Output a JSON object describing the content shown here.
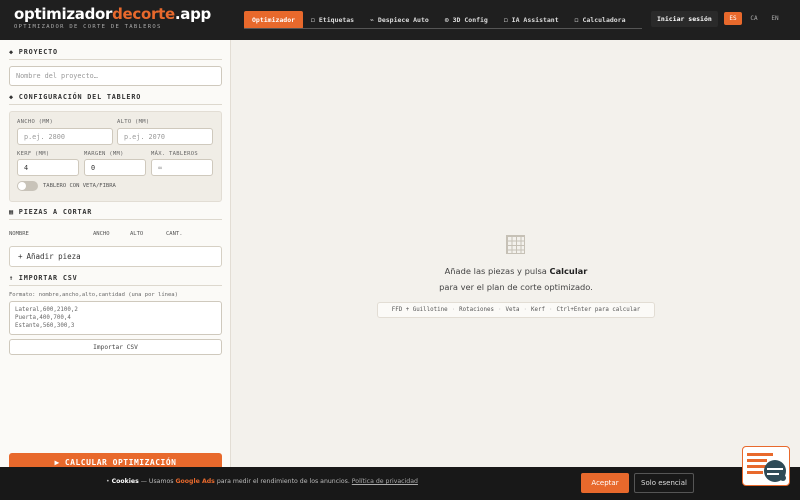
{
  "header": {
    "logo_main": "optimizador",
    "logo_accent": "decorte",
    "logo_tld": ".app",
    "logo_subtitle": "OPTIMIZADOR DE CORTE DE TABLEROS",
    "nav": [
      {
        "label": "Optimizador",
        "active": true
      },
      {
        "label": "◻ Etiquetas",
        "active": false
      },
      {
        "label": "⌁ Despiece Auto",
        "active": false
      },
      {
        "label": "⊙ 3D Config",
        "active": false
      },
      {
        "label": "◻ IA Assistant",
        "active": false
      },
      {
        "label": "◻ Calculadora",
        "active": false
      }
    ],
    "login_label": "Iniciar sesión",
    "languages": [
      {
        "code": "ES",
        "active": true
      },
      {
        "code": "CA",
        "active": false
      },
      {
        "code": "EN",
        "active": false
      }
    ]
  },
  "sidebar": {
    "project": {
      "title": "PROYECTO",
      "name_placeholder": "Nombre del proyecto…"
    },
    "board_config": {
      "title": "CONFIGURACIÓN DEL TABLERO",
      "width_label": "ANCHO (MM)",
      "width_placeholder": "p.ej. 2800",
      "height_label": "ALTO (MM)",
      "height_placeholder": "p.ej. 2070",
      "kerf_label": "KERF (MM)",
      "kerf_value": "4",
      "margin_label": "MARGEN (MM)",
      "margin_value": "0",
      "max_boards_label": "MÁX. TABLEROS",
      "max_boards_placeholder": "∞",
      "grain_toggle_label": "TABLERO CON VETA/FIBRA",
      "grain_enabled": false
    },
    "pieces": {
      "title": "PIEZAS A CORTAR",
      "columns": [
        "NOMBRE",
        "ANCHO",
        "ALTO",
        "CANT."
      ],
      "add_label": "Añadir pieza"
    },
    "csv": {
      "title": "IMPORTAR CSV",
      "format_note": "Formato: nombre,ancho,alto,cantidad (una por línea)",
      "sample_lines": [
        "Lateral,600,2100,2",
        "Puerta,400,700,4",
        "Estante,560,300,3"
      ],
      "import_label": "Importar CSV"
    },
    "calculate_label": "CALCULAR OPTIMIZACIÓN"
  },
  "main": {
    "empty_prefix": "Añade las piezas y pulsa ",
    "empty_action": "Calcular",
    "empty_line2": "para ver el plan de corte optimizado.",
    "hints": [
      "FFD + Guillotine",
      "Rotaciones",
      "Veta",
      "Kerf",
      "Ctrl+Enter para calcular"
    ]
  },
  "cookie": {
    "title": "Cookies",
    "text_before": " — Usamos ",
    "brand": "Google Ads",
    "text_after": " para medir el rendimiento de los anuncios. ",
    "policy_link": "Política de privacidad",
    "accept_label": "Aceptar",
    "essential_label": "Solo esencial"
  },
  "colors": {
    "accent": "#e8692c",
    "header_bg": "#1f1f1f",
    "page_bg": "#f3f1ec"
  }
}
